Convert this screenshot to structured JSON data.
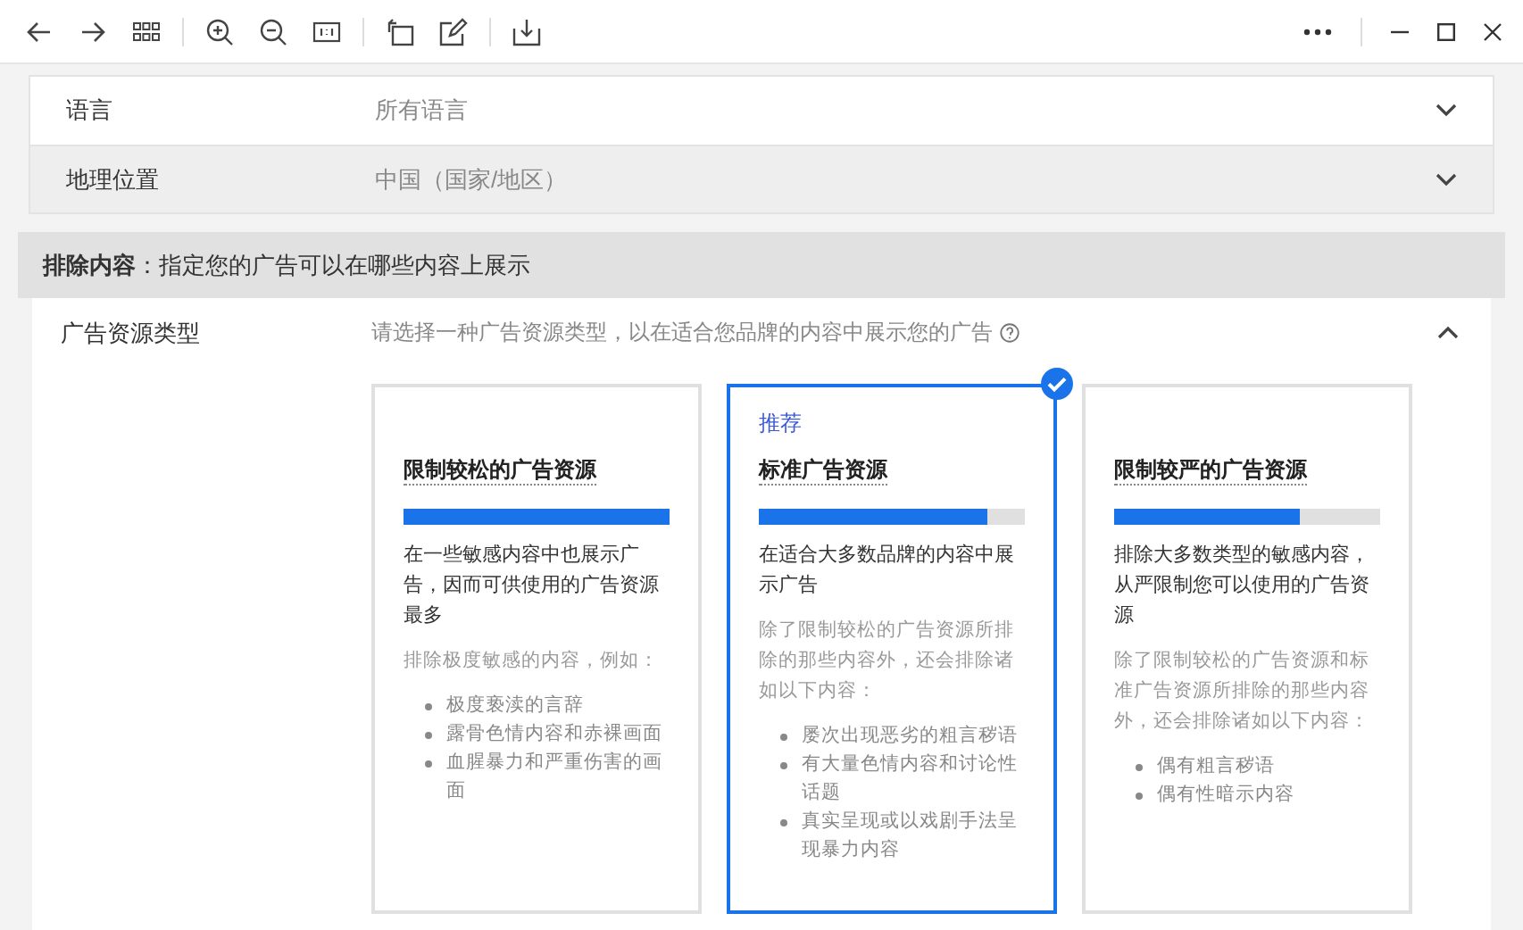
{
  "settings": [
    {
      "label": "语言",
      "value": "所有语言",
      "expanded": false
    },
    {
      "label": "地理位置",
      "value": "中国（国家/地区）",
      "expanded": false
    }
  ],
  "exclusion": {
    "heading": "**排除内容**：指定您的广告可以在哪些内容上展示",
    "label": "广告资源类型",
    "hint": "请选择一种广告资源类型，以在适合您品牌的内容中展示您的广告",
    "expanded": true,
    "cards": [
      {
        "title": "限制较松的广告资源",
        "level": 1.0,
        "selected": false,
        "description": "在一些敏感内容中也展示广告，因而可供使用的广告资源最多",
        "detail": "排除极度敏感的内容，例如：",
        "bullets": [
          "极度亵渎的言辞",
          "露骨色情内容和赤裸画面",
          "血腥暴力和严重伤害的画面"
        ]
      },
      {
        "tag": "推荐",
        "title": "标准广告资源",
        "level": 0.86,
        "selected": true,
        "description": "在适合大多数品牌的内容中展示广告",
        "detail": "除了限制较松的广告资源所排除的那些内容外，还会排除诸如以下内容：",
        "bullets": [
          "屡次出现恶劣的粗言秽语",
          "有大量色情内容和讨论性话题",
          "真实呈现或以戏剧手法呈现暴力内容"
        ]
      },
      {
        "title": "限制较严的广告资源",
        "level": 0.7,
        "selected": false,
        "description": "排除大多数类型的敏感内容，从严限制您可以使用的广告资源",
        "detail": "除了限制较松的广告资源和标准广告资源所排除的那些内容外，还会排除诸如以下内容：",
        "bullets": [
          "偶有粗言秽语",
          "偶有性暗示内容"
        ]
      }
    ]
  }
}
